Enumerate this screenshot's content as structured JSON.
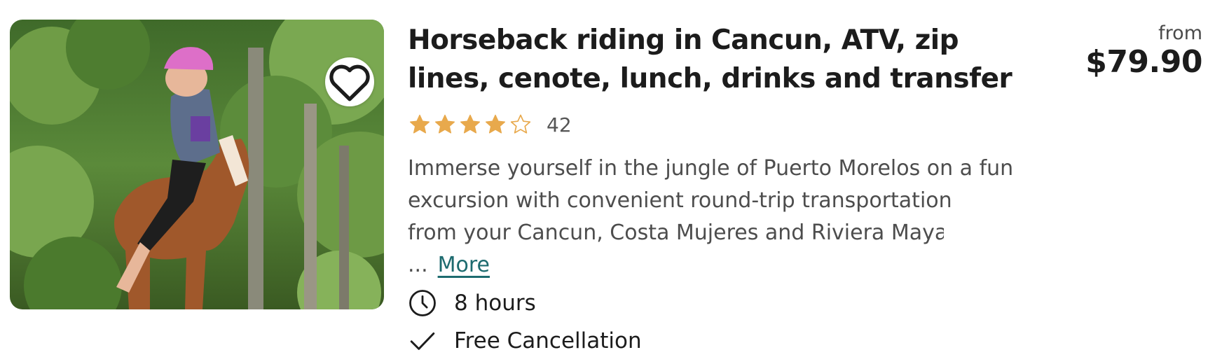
{
  "listing": {
    "title": "Horseback riding in Cancun, ATV, zip lines, cenote, lunch, drinks and transfer",
    "rating": {
      "stars": 4,
      "max_stars": 5,
      "count": "42"
    },
    "description": "Immerse yourself in the jungle of Puerto Morelos on a fun excursion with convenient round-trip transportation from your Cancun, Costa Mujeres and Riviera Maya",
    "description_lines": [
      "Immerse yourself in the jungle of Puerto Morelos on a fun",
      "excursion with convenient round-trip transportation",
      "from your Cancun, Costa Mujeres and Riviera Maya"
    ],
    "ellipsis": "...",
    "more_label": "More",
    "duration": "8 hours",
    "cancellation": "Free Cancellation",
    "price": {
      "from_label": "from",
      "amount": "$79.90"
    }
  },
  "icons": {
    "favorite": "heart-outline-icon",
    "duration": "clock-icon",
    "cancellation": "checkmark-icon",
    "star_filled": "star-filled-icon",
    "star_empty": "star-outline-icon"
  },
  "colors": {
    "star": "#E8A94C",
    "link": "#1D6B6F",
    "text": "#1C1C1C",
    "muted": "#4D4D4D"
  }
}
